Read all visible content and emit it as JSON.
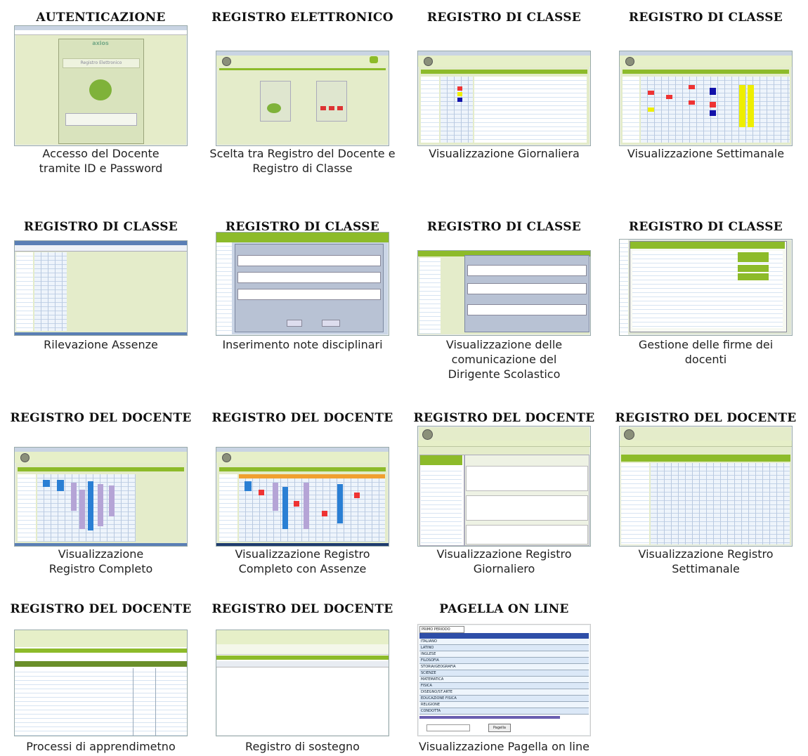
{
  "items": [
    {
      "title": "AUTENTICAZIONE",
      "caption": "Accesso del Docente tramite ID e Password"
    },
    {
      "title": "REGISTRO ELETTRONICO",
      "caption": "Scelta tra Registro del Docente e Registro di Classe"
    },
    {
      "title": "REGISTRO DI CLASSE",
      "caption": "Visualizzazione Giornaliera"
    },
    {
      "title": "REGISTRO DI CLASSE",
      "caption": "Visualizzazione Settimanale"
    },
    {
      "title": "REGISTRO DI CLASSE",
      "caption": "Rilevazione Assenze"
    },
    {
      "title": "REGISTRO DI CLASSE",
      "caption": "Inserimento note disciplinari"
    },
    {
      "title": "REGISTRO DI CLASSE",
      "caption": "Visualizzazione delle comunicazione del Dirigente Scolastico"
    },
    {
      "title": "REGISTRO DI CLASSE",
      "caption": "Gestione delle firme dei docenti"
    },
    {
      "title": "REGISTRO DEL DOCENTE",
      "caption": "Visualizzazione Registro Completo"
    },
    {
      "title": "REGISTRO DEL DOCENTE",
      "caption": "Visualizzazione Registro Completo con Assenze"
    },
    {
      "title": "REGISTRO DEL DOCENTE",
      "caption": "Visualizzazione Registro Giornaliero"
    },
    {
      "title": "REGISTRO DEL DOCENTE",
      "caption": "Visualizzazione Registro Settimanale"
    },
    {
      "title": "REGISTRO DEL DOCENTE",
      "caption": "Processi di apprendimetno"
    },
    {
      "title": "REGISTRO DEL DOCENTE",
      "caption": "Registro di sostegno"
    },
    {
      "title": "PAGELLA ON LINE",
      "caption": "Visualizzazione Pagella on line"
    }
  ],
  "login_thumb": {
    "brand": "axios",
    "product": "Registro Elettronico"
  },
  "pagella_thumb": {
    "period": "PRIMO PERIODO",
    "subjects": [
      "ITALIANO",
      "LATINO",
      "INGLESE",
      "FILOSOFIA",
      "STORIA/GEOGRAFIA",
      "SCIENZE",
      "MATEMATICA",
      "FISICA",
      "DISEGNO/ST.ARTE",
      "EDUCAZIONE FISICA",
      "RELIGIONE",
      "CONDOTTA"
    ],
    "button": "Pagella"
  }
}
